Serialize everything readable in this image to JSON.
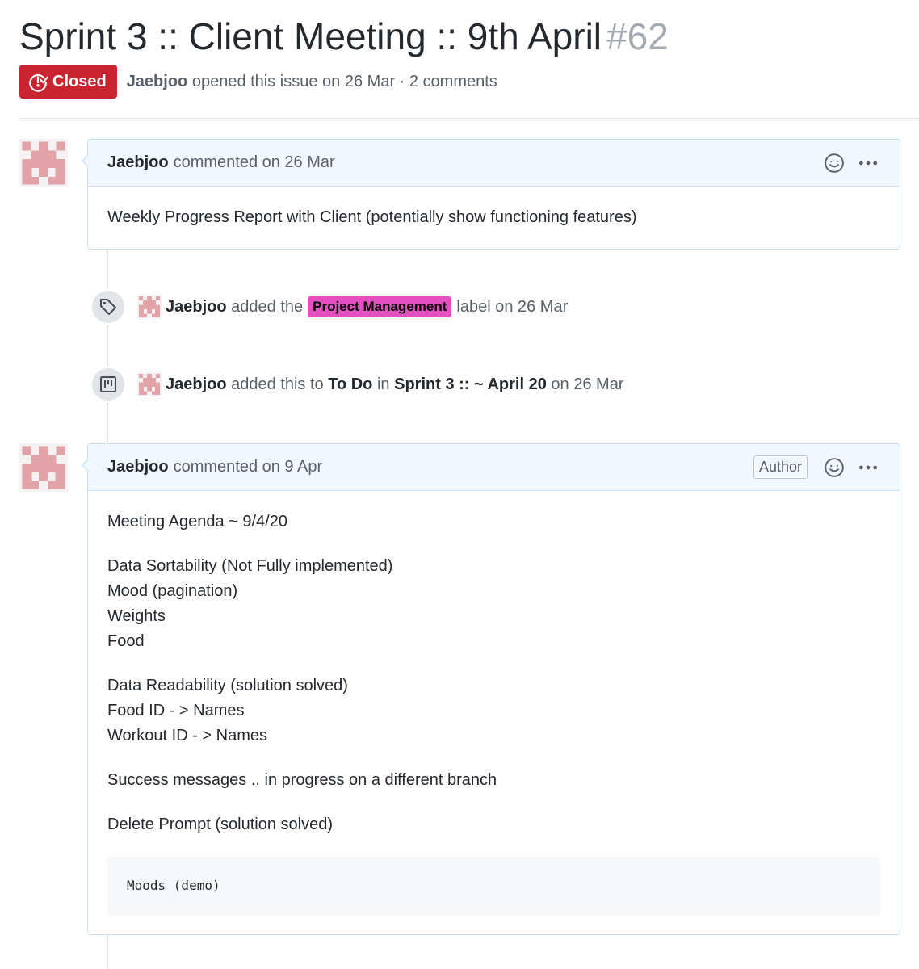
{
  "issue": {
    "title": "Sprint 3 :: Client Meeting :: 9th April",
    "number": "#62",
    "state": "Closed",
    "author": "Jaebjoo",
    "opened_text": "opened this issue on 26 Mar · 2 comments",
    "state_color": "#cb2431"
  },
  "comment1": {
    "author": "Jaebjoo",
    "date_text": "commented on 26 Mar",
    "body": "Weekly Progress Report with Client (potentially show functioning features)"
  },
  "event1": {
    "actor": "Jaebjoo",
    "text_before": "added the",
    "label": "Project Management",
    "label_color": "#e54fc0",
    "text_after": "label on 26 Mar"
  },
  "event2": {
    "actor": "Jaebjoo",
    "text_before": "added this to",
    "column": "To Do",
    "text_in": "in",
    "project": "Sprint 3 :: ~ April 20",
    "text_after": "on 26 Mar"
  },
  "comment2": {
    "author": "Jaebjoo",
    "date_text": "commented on 9 Apr",
    "author_badge": "Author",
    "p1": [
      "Meeting Agenda ~ 9/4/20"
    ],
    "p2": [
      "Data Sortability (Not Fully implemented)",
      "Mood (pagination)",
      "Weights",
      "Food"
    ],
    "p3": [
      "Data Readability (solution solved)",
      "Food ID - > Names",
      "Workout ID - > Names"
    ],
    "p4": [
      "Success messages .. in progress on a different branch"
    ],
    "p5": [
      "Delete Prompt (solution solved)"
    ],
    "code": "Moods (demo)"
  },
  "icons": {
    "state": "issue-closed-icon",
    "reaction": "smiley-icon",
    "more": "kebab-horizontal-icon",
    "label_event": "tag-icon",
    "project_event": "project-icon",
    "avatar": "identicon-avatar"
  }
}
